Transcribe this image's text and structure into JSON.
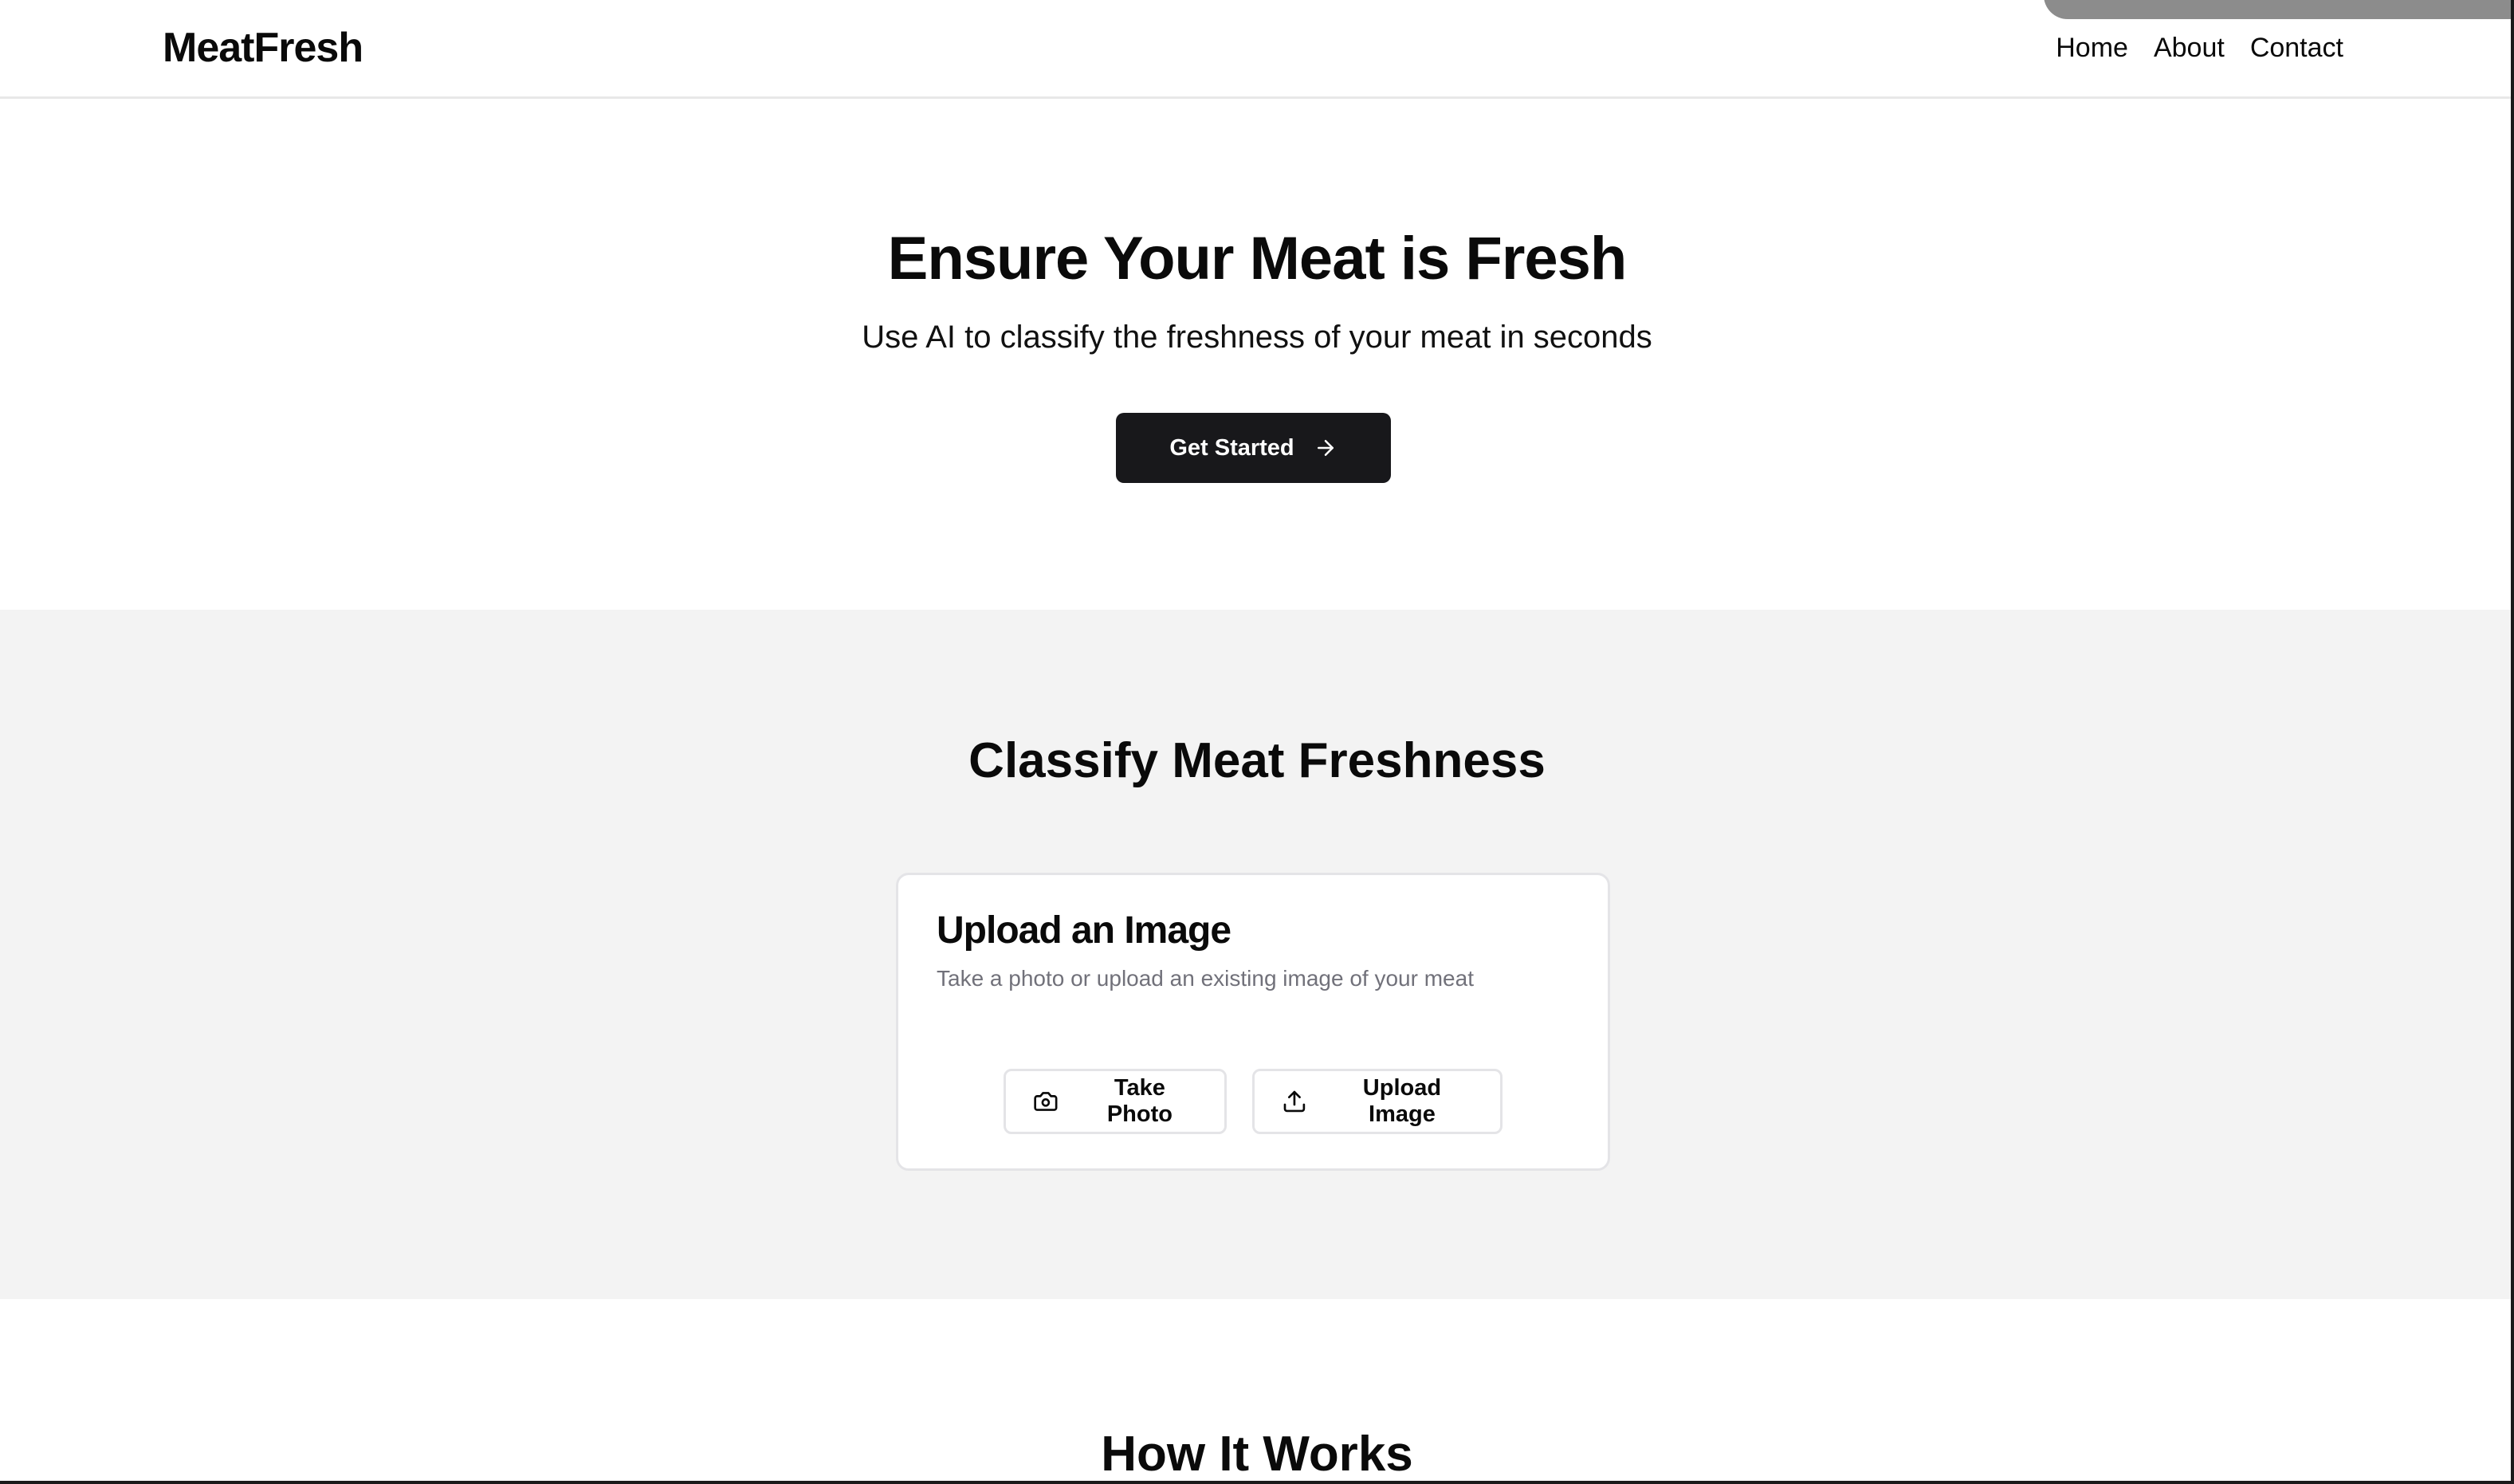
{
  "brand": {
    "name": "MeatFresh"
  },
  "nav": {
    "items": [
      {
        "label": "Home"
      },
      {
        "label": "About"
      },
      {
        "label": "Contact"
      }
    ]
  },
  "hero": {
    "title": "Ensure Your Meat is Fresh",
    "subtitle": "Use AI to classify the freshness of your meat in seconds",
    "cta_label": "Get Started",
    "cta_icon": "arrow-right-icon"
  },
  "classify": {
    "title": "Classify Meat Freshness",
    "card": {
      "title": "Upload an Image",
      "description": "Take a photo or upload an existing image of your meat",
      "take_photo_label": "Take Photo",
      "take_photo_icon": "camera-icon",
      "upload_label": "Upload Image",
      "upload_icon": "upload-icon"
    }
  },
  "how": {
    "title": "How It Works"
  },
  "colors": {
    "primary_button": "#18181b",
    "section_bg": "#f3f3f3",
    "muted_text": "#71717a",
    "border": "#e4e4e7"
  }
}
